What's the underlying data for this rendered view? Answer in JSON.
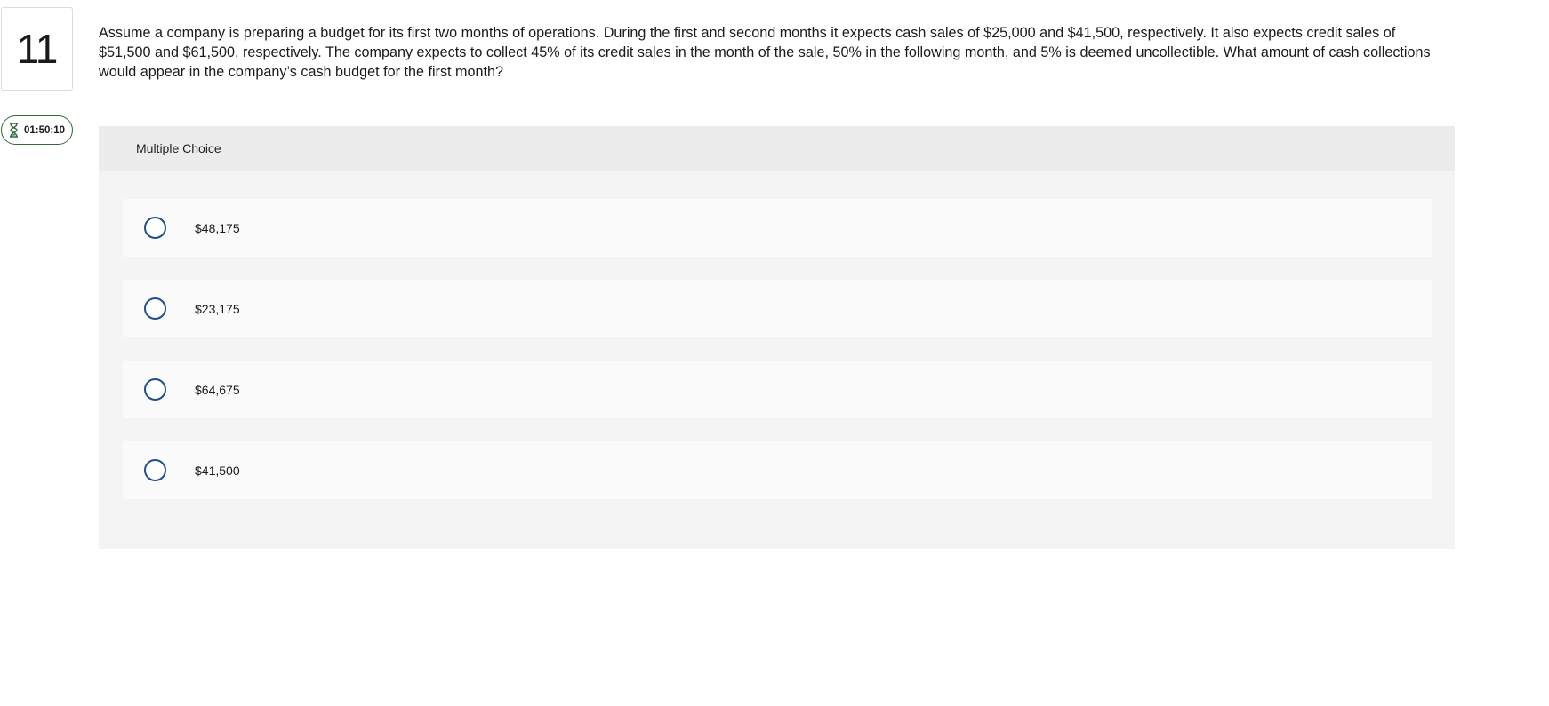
{
  "question": {
    "number": "11",
    "text": "Assume a company is preparing a budget for its first two months of operations. During the first and second months it expects cash sales of $25,000 and $41,500, respectively. It also expects credit sales of $51,500 and $61,500, respectively. The company expects to collect 45% of its credit sales in the month of the sale, 50% in the following month, and 5% is deemed uncollectible. What amount of cash collections would appear in the company’s cash budget for the first month?"
  },
  "timer": {
    "icon": "hourglass-icon",
    "value": "01:50:10",
    "color": "#2f6b3a"
  },
  "panel": {
    "title": "Multiple Choice",
    "choices": [
      {
        "label": "$48,175"
      },
      {
        "label": "$23,175"
      },
      {
        "label": "$64,675"
      },
      {
        "label": "$41,500"
      }
    ]
  },
  "colors": {
    "radio_border": "#1f4f8a",
    "panel_bg": "#f4f4f4",
    "header_bg": "#ececec",
    "choice_bg": "#fafafa"
  }
}
